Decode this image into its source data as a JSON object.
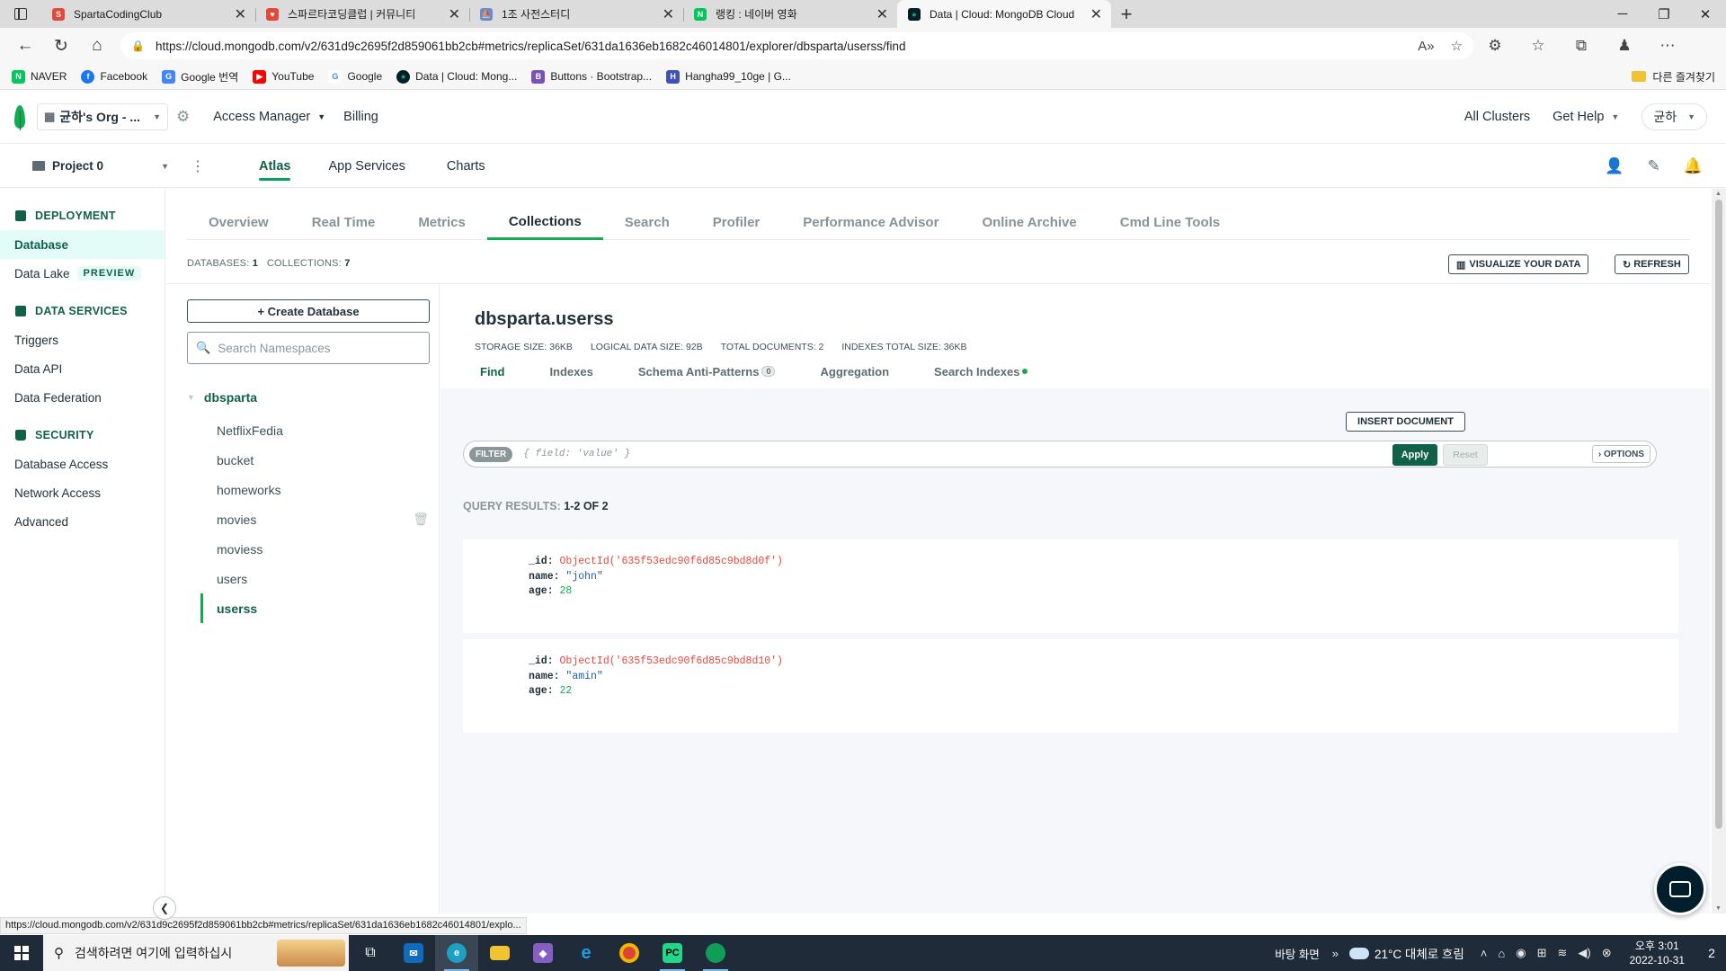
{
  "browser": {
    "tabs": [
      {
        "title": "SpartaCodingClub",
        "color": "#e5483b",
        "glyph": "S"
      },
      {
        "title": "스파르타코딩클럽 | 커뮤니티",
        "color": "#e5483b",
        "glyph": "♥"
      },
      {
        "title": "1조 사전스터디",
        "color": "#6a8cc7",
        "glyph": "⛵"
      },
      {
        "title": "랭킹 : 네이버 영화",
        "color": "#03c75a",
        "glyph": "N"
      },
      {
        "title": "Data | Cloud: MongoDB Cloud",
        "color": "#001e2b",
        "glyph": "●"
      }
    ],
    "url": "https://cloud.mongodb.com/v2/631d9c2695f2d859061bb2cb#metrics/replicaSet/631da1636eb1682c46014801/explorer/dbsparta/userss/find",
    "bookmarks": [
      {
        "label": "NAVER",
        "color": "#03c75a",
        "glyph": "N"
      },
      {
        "label": "Facebook",
        "color": "#1877f2",
        "glyph": "f"
      },
      {
        "label": "Google 번역",
        "color": "#4285f4",
        "glyph": "G"
      },
      {
        "label": "YouTube",
        "color": "#ff0000",
        "glyph": "▶"
      },
      {
        "label": "Google",
        "color": "#ffffff",
        "glyph": "G"
      },
      {
        "label": "Data | Cloud: Mong...",
        "color": "#001e2b",
        "glyph": "●"
      },
      {
        "label": "Buttons · Bootstrap...",
        "color": "#7952b3",
        "glyph": "B"
      },
      {
        "label": "Hangha99_10ge | G...",
        "color": "#3f51b5",
        "glyph": "H"
      }
    ],
    "other_bookmarks": "다른 즐겨찾기",
    "status_url": "https://cloud.mongodb.com/v2/631d9c2695f2d859061bb2cb#metrics/replicaSet/631da1636eb1682c46014801/explo..."
  },
  "atlas_header": {
    "org": "균하's Org - ...",
    "access_manager": "Access Manager",
    "billing": "Billing",
    "all_clusters": "All Clusters",
    "get_help": "Get Help",
    "user": "균하"
  },
  "project_bar": {
    "project": "Project 0",
    "tabs": [
      "Atlas",
      "App Services",
      "Charts"
    ],
    "active_tab": "Atlas"
  },
  "sidebar": {
    "deployment": "DEPLOYMENT",
    "database": "Database",
    "data_lake": "Data Lake",
    "preview": "PREVIEW",
    "data_services": "DATA SERVICES",
    "triggers": "Triggers",
    "data_api": "Data API",
    "data_federation": "Data Federation",
    "security": "SECURITY",
    "database_access": "Database Access",
    "network_access": "Network Access",
    "advanced": "Advanced"
  },
  "cluster_tabs": [
    "Overview",
    "Real Time",
    "Metrics",
    "Collections",
    "Search",
    "Profiler",
    "Performance Advisor",
    "Online Archive",
    "Cmd Line Tools"
  ],
  "active_cluster_tab": "Collections",
  "counts": {
    "databases_label": "DATABASES:",
    "databases": "1",
    "collections_label": "COLLECTIONS:",
    "collections": "7"
  },
  "buttons": {
    "visualize": "VISUALIZE YOUR DATA",
    "refresh": "REFRESH",
    "create_database": "+ Create Database",
    "insert_document": "INSERT DOCUMENT",
    "options": "› OPTIONS",
    "apply": "Apply",
    "reset": "Reset"
  },
  "namespace": {
    "search_placeholder": "Search Namespaces",
    "database": "dbsparta",
    "collections": [
      "NetflixFedia",
      "bucket",
      "homeworks",
      "movies",
      "moviess",
      "users",
      "userss"
    ],
    "active_collection": "userss"
  },
  "collection": {
    "title": "dbsparta.userss",
    "storage_size_label": "STORAGE SIZE:",
    "storage_size": "36KB",
    "logical_size_label": "LOGICAL DATA SIZE:",
    "logical_size": "92B",
    "total_docs_label": "TOTAL DOCUMENTS:",
    "total_docs": "2",
    "indexes_size_label": "INDEXES TOTAL SIZE:",
    "indexes_size": "36KB",
    "tabs": {
      "find": "Find",
      "indexes": "Indexes",
      "schema": "Schema Anti-Patterns",
      "schema_count": "0",
      "aggregation": "Aggregation",
      "search_indexes": "Search Indexes"
    }
  },
  "filter": {
    "label": "FILTER",
    "placeholder": "{ field: 'value' }"
  },
  "results": {
    "label": "QUERY RESULTS:",
    "range": "1-2 OF 2",
    "documents": [
      {
        "id": "ObjectId('635f53edc90f6d85c9bd8d0f')",
        "name": "\"john\"",
        "age": "28"
      },
      {
        "id": "ObjectId('635f53edc90f6d85c9bd8d10')",
        "name": "\"amin\"",
        "age": "22"
      }
    ],
    "keys": {
      "id": "_id:",
      "name": "name:",
      "age": "age:"
    }
  },
  "taskbar": {
    "search": "검색하려면 여기에 입력하십시",
    "desktop": "바탕 화면",
    "weather": "21°C 대체로 흐림",
    "time": "오후 3:01",
    "date": "2022-10-31",
    "notifications": "2"
  }
}
